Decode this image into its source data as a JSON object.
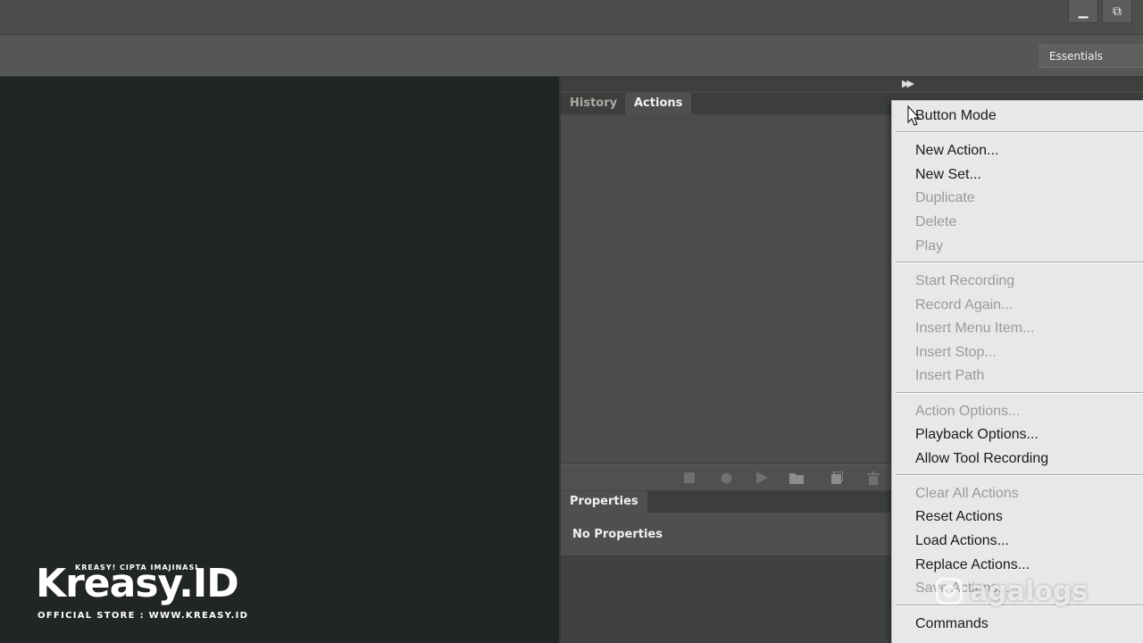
{
  "workspace": {
    "label": "Essentials"
  },
  "window_controls": {
    "minimize_glyph": "▁",
    "restore_glyph": "⧉"
  },
  "actions_panel": {
    "tabs": [
      {
        "label": "History",
        "active": false
      },
      {
        "label": "Actions",
        "active": true
      }
    ],
    "footer_buttons": [
      "stop-icon",
      "record-icon",
      "play-icon",
      "folder-icon",
      "new-action-icon",
      "trash-icon"
    ]
  },
  "properties_panel": {
    "tab_label": "Properties",
    "empty_text": "No Properties"
  },
  "context_menu": {
    "items": [
      {
        "label": "Button Mode",
        "disabled": false
      },
      {
        "label": "New Action...",
        "disabled": false
      },
      {
        "label": "New Set...",
        "disabled": false
      },
      {
        "label": "Duplicate",
        "disabled": true
      },
      {
        "label": "Delete",
        "disabled": true
      },
      {
        "label": "Play",
        "disabled": true
      },
      {
        "label": "Start Recording",
        "disabled": true
      },
      {
        "label": "Record Again...",
        "disabled": true
      },
      {
        "label": "Insert Menu Item...",
        "disabled": true
      },
      {
        "label": "Insert Stop...",
        "disabled": true
      },
      {
        "label": "Insert Path",
        "disabled": true
      },
      {
        "label": "Action Options...",
        "disabled": true
      },
      {
        "label": "Playback Options...",
        "disabled": false
      },
      {
        "label": "Allow Tool Recording",
        "disabled": false
      },
      {
        "label": "Clear All Actions",
        "disabled": true
      },
      {
        "label": "Reset Actions",
        "disabled": false
      },
      {
        "label": "Load Actions...",
        "disabled": false
      },
      {
        "label": "Replace Actions...",
        "disabled": false
      },
      {
        "label": "Save Actions...",
        "disabled": true
      },
      {
        "label": "Commands",
        "disabled": false
      }
    ]
  },
  "branding": {
    "logo_text": "Kreasy.ID",
    "logo_tagline": "KREASY! CIPTA IMAJINASI",
    "store_text": "OFFICIAL STORE : WWW.KREASY.ID",
    "watermark_text": "agalogs"
  },
  "colors": {
    "canvas": "#222622",
    "panel": "#4a4d49",
    "menu_bg": "#e8e8e8",
    "menu_text": "#1a1a1a",
    "menu_disabled": "#9a9a9a"
  }
}
